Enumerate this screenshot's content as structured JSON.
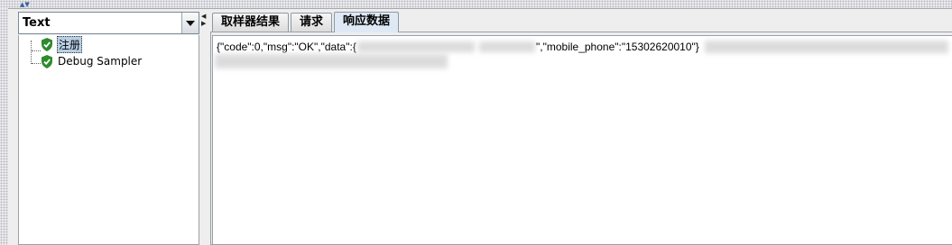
{
  "renderer": {
    "selected": "Text"
  },
  "tree": {
    "items": [
      {
        "label": "注册",
        "selected": true
      },
      {
        "label": "Debug Sampler",
        "selected": false
      }
    ]
  },
  "tabs": [
    {
      "label": "取样器结果"
    },
    {
      "label": "请求"
    },
    {
      "label": "响应数据"
    }
  ],
  "response": {
    "part1": "{\"code\":0,\"msg\":\"OK\",\"data\":{",
    "part2": "\",\"mobile_phone\":\"15302620010\"}"
  },
  "colors": {
    "success_icon": "#2e8b2e",
    "selection": "#b8cfe5"
  },
  "icons": {
    "tree_node": "green-shield-check-icon",
    "dropdown": "chevron-down-icon"
  }
}
